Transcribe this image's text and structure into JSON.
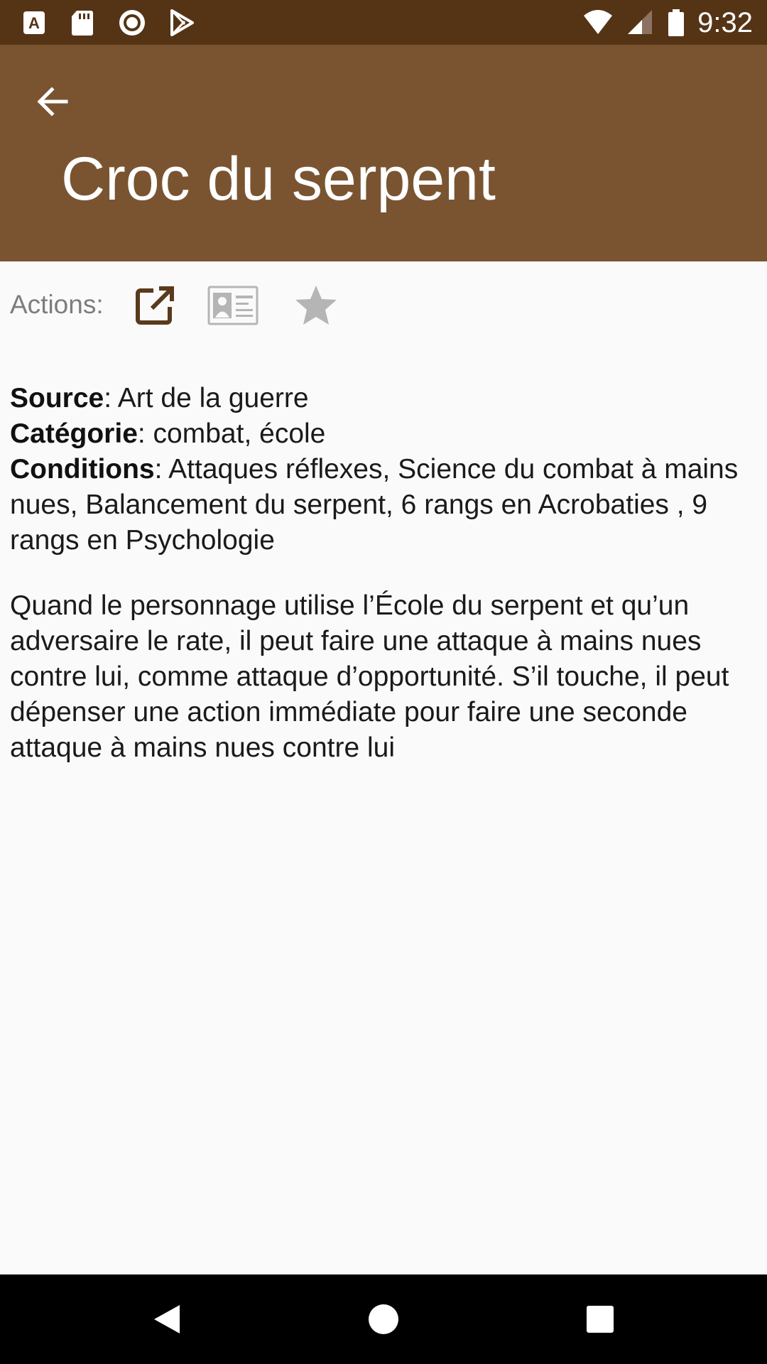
{
  "status_bar": {
    "time": "9:32",
    "left_icons": [
      "a-badge-icon",
      "sd-card-icon",
      "record-icon",
      "play-store-icon"
    ],
    "right_icons": [
      "wifi-icon",
      "signal-icon",
      "battery-icon"
    ]
  },
  "toolbar": {
    "back_icon": "arrow-left-icon",
    "title": "Croc du serpent",
    "color": "#7a5431",
    "status_color": "#553416"
  },
  "actions": {
    "label": "Actions:",
    "buttons": [
      {
        "icon": "open-external-icon",
        "color": "#5a3a1c"
      },
      {
        "icon": "id-card-icon",
        "color": "#b5b5b5"
      },
      {
        "icon": "star-icon",
        "color": "#b5b5b5"
      }
    ]
  },
  "details": {
    "source_label": "Source",
    "source_value": ": Art de la guerre",
    "category_label": "Catégorie",
    "category_value": ": combat, école",
    "conditions_label": "Conditions",
    "conditions_value": ": Attaques réflexes, Science du combat à mains nues, Balancement du serpent, 6 rangs en Acrobaties , 9 rangs en Psychologie"
  },
  "description": "Quand le personnage utilise l’École du serpent et qu’un adversaire le rate, il peut faire une attaque à mains nues contre lui, comme attaque d’opportunité. S’il touche, il peut dépenser une action immédiate pour faire une seconde attaque à mains nues contre lui",
  "nav_bar": {
    "icons": [
      "nav-back-icon",
      "nav-home-icon",
      "nav-recents-icon"
    ]
  }
}
